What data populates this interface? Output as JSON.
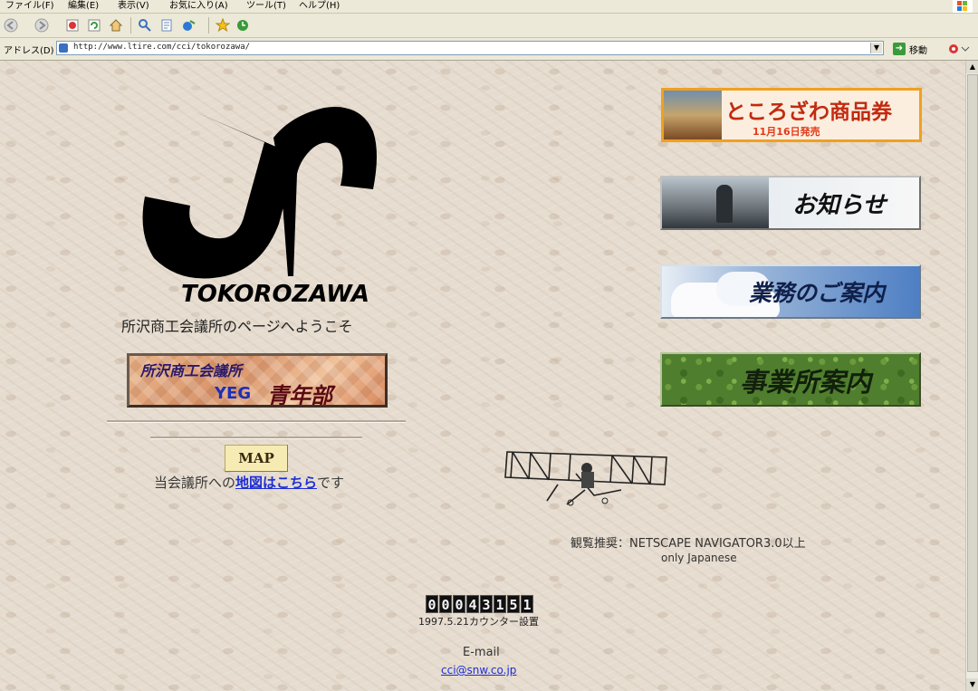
{
  "browser": {
    "menu": [
      "ファイル(F)",
      "編集(E)",
      "表示(V)",
      "お気に入り(A)",
      "ツール(T)",
      "ヘルプ(H)"
    ],
    "address_label": "アドレス(D)",
    "url": "http://www.ltire.com/cci/tokorozawa/",
    "go_label": "移動"
  },
  "page": {
    "logo_word": "TOKOROZAWA",
    "welcome": "所沢商工会議所のページへようこそ",
    "yeg_banner": {
      "top": "所沢商工会議所",
      "tag": "YEG",
      "kanji": "青年部"
    },
    "map_button": "MAP",
    "map_prefix": "当会議所への",
    "map_link": "地図はこちら",
    "map_suffix": "です",
    "banners": [
      {
        "title": "ところざわ商品券",
        "subtitle": "11月16日発売"
      },
      {
        "title": "お知らせ"
      },
      {
        "title": "業務のご案内"
      },
      {
        "title": "事業所案内"
      }
    ],
    "recommend": "観覧推奨：NETSCAPE NAVIGATOR3.0以上",
    "recommend_lang": "only Japanese",
    "counter_digits": [
      "0",
      "0",
      "0",
      "4",
      "3",
      "1",
      "5",
      "1"
    ],
    "counter_note": "1997.5.21カウンター設置",
    "email_label": "E-mail",
    "email_address": "cci@snw.co.jp"
  },
  "colors": {
    "link": "#1c2ed6",
    "background": "#e6dccf",
    "chrome": "#ece9d8"
  }
}
